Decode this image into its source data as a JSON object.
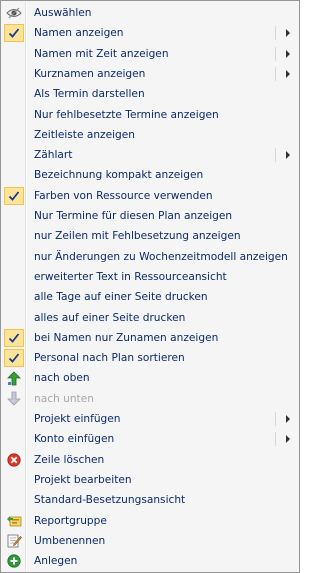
{
  "menu": {
    "items": [
      {
        "label": "Auswählen",
        "icon": "eye-icon",
        "checked": false,
        "submenu": false,
        "disabled": false
      },
      {
        "label": "Namen anzeigen",
        "icon": "check-icon",
        "checked": true,
        "submenu": true,
        "disabled": false
      },
      {
        "label": "Namen mit Zeit anzeigen",
        "icon": "",
        "checked": false,
        "submenu": true,
        "disabled": false
      },
      {
        "label": "Kurznamen anzeigen",
        "icon": "",
        "checked": false,
        "submenu": true,
        "disabled": false
      },
      {
        "label": "Als Termin darstellen",
        "icon": "",
        "checked": false,
        "submenu": false,
        "disabled": false
      },
      {
        "label": "Nur fehlbesetzte Termine anzeigen",
        "icon": "",
        "checked": false,
        "submenu": false,
        "disabled": false
      },
      {
        "label": "Zeitleiste anzeigen",
        "icon": "",
        "checked": false,
        "submenu": false,
        "disabled": false
      },
      {
        "label": "Zählart",
        "icon": "",
        "checked": false,
        "submenu": true,
        "disabled": false
      },
      {
        "label": "Bezeichnung kompakt anzeigen",
        "icon": "",
        "checked": false,
        "submenu": false,
        "disabled": false
      },
      {
        "label": "Farben von Ressource verwenden",
        "icon": "check-icon",
        "checked": true,
        "submenu": false,
        "disabled": false
      },
      {
        "label": "Nur Termine für diesen Plan anzeigen",
        "icon": "",
        "checked": false,
        "submenu": false,
        "disabled": false
      },
      {
        "label": "nur Zeilen mit Fehlbesetzung anzeigen",
        "icon": "",
        "checked": false,
        "submenu": false,
        "disabled": false
      },
      {
        "label": "nur Änderungen zu Wochenzeitmodell anzeigen",
        "icon": "",
        "checked": false,
        "submenu": false,
        "disabled": false
      },
      {
        "label": "erweiterter Text in Ressourceansicht",
        "icon": "",
        "checked": false,
        "submenu": false,
        "disabled": false
      },
      {
        "label": "alle Tage auf einer Seite drucken",
        "icon": "",
        "checked": false,
        "submenu": false,
        "disabled": false
      },
      {
        "label": "alles auf einer Seite drucken",
        "icon": "",
        "checked": false,
        "submenu": false,
        "disabled": false
      },
      {
        "label": "bei Namen nur Zunamen anzeigen",
        "icon": "check-icon",
        "checked": true,
        "submenu": false,
        "disabled": false
      },
      {
        "label": "Personal nach Plan sortieren",
        "icon": "check-icon",
        "checked": true,
        "submenu": false,
        "disabled": false
      },
      {
        "label": "nach oben",
        "icon": "arrow-up-icon",
        "checked": false,
        "submenu": false,
        "disabled": false
      },
      {
        "label": "nach unten",
        "icon": "arrow-down-icon",
        "checked": false,
        "submenu": false,
        "disabled": true
      },
      {
        "label": "Projekt einfügen",
        "icon": "",
        "checked": false,
        "submenu": true,
        "disabled": false
      },
      {
        "label": "Konto einfügen",
        "icon": "",
        "checked": false,
        "submenu": true,
        "disabled": false
      },
      {
        "label": "Zeile löschen",
        "icon": "delete-icon",
        "checked": false,
        "submenu": false,
        "disabled": false
      },
      {
        "label": "Projekt bearbeiten",
        "icon": "",
        "checked": false,
        "submenu": false,
        "disabled": false
      },
      {
        "label": "Standard-Besetzungsansicht",
        "icon": "",
        "checked": false,
        "submenu": false,
        "disabled": false
      },
      {
        "label": "Reportgruppe",
        "icon": "report-group-icon",
        "checked": false,
        "submenu": false,
        "disabled": false
      },
      {
        "label": "Umbenennen",
        "icon": "rename-icon",
        "checked": false,
        "submenu": false,
        "disabled": false
      },
      {
        "label": "Anlegen",
        "icon": "add-icon",
        "checked": false,
        "submenu": false,
        "disabled": false
      }
    ]
  },
  "colors": {
    "text": "#0b2a6a",
    "disabled_text": "#a7a7a7",
    "check_bg": "#fce39a",
    "check_border": "#f2c24e",
    "delete_red": "#d83b2c",
    "add_green": "#2e9b3a",
    "arrow_green": "#3b9c3b"
  }
}
